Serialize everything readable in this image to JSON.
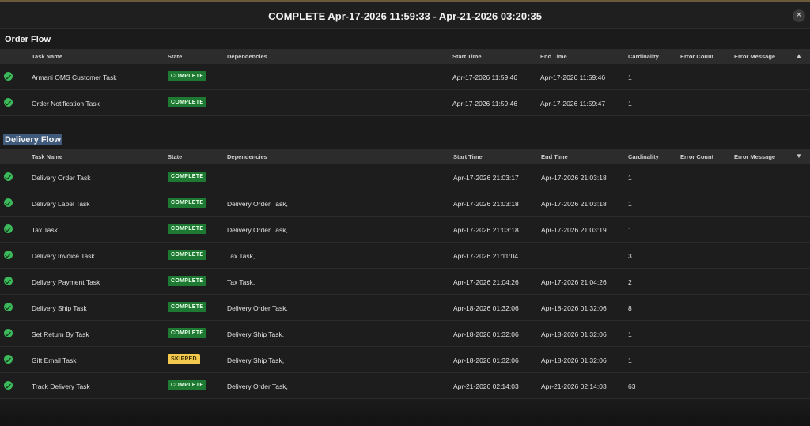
{
  "header": {
    "title": "COMPLETE Apr-17-2026 11:59:33 - Apr-21-2026 03:20:35",
    "close_icon": "close-icon"
  },
  "columns": [
    "Task Name",
    "State",
    "Dependencies",
    "Start Time",
    "End Time",
    "Cardinality",
    "Error Count",
    "Error Message"
  ],
  "order_flow": {
    "title": "Order Flow",
    "collapse_icon": "chevron-up-icon",
    "rows": [
      {
        "name": "Armani OMS Customer Task",
        "state": "COMPLETE",
        "deps": "",
        "start": "Apr-17-2026 11:59:46",
        "end": "Apr-17-2026 11:59:46",
        "card": "1"
      },
      {
        "name": "Order Notification Task",
        "state": "COMPLETE",
        "deps": "",
        "start": "Apr-17-2026 11:59:46",
        "end": "Apr-17-2026 11:59:47",
        "card": "1"
      }
    ]
  },
  "delivery_flow": {
    "title": "Delivery Flow",
    "collapse_icon": "chevron-down-icon",
    "rows": [
      {
        "name": "Delivery Order Task",
        "state": "COMPLETE",
        "deps": "",
        "start": "Apr-17-2026 21:03:17",
        "end": "Apr-17-2026 21:03:18",
        "card": "1"
      },
      {
        "name": "Delivery Label Task",
        "state": "COMPLETE",
        "deps": "Delivery Order Task,",
        "start": "Apr-17-2026 21:03:18",
        "end": "Apr-17-2026 21:03:18",
        "card": "1"
      },
      {
        "name": "Tax Task",
        "state": "COMPLETE",
        "deps": "Delivery Order Task,",
        "start": "Apr-17-2026 21:03:18",
        "end": "Apr-17-2026 21:03:19",
        "card": "1"
      },
      {
        "name": "Delivery Invoice Task",
        "state": "COMPLETE",
        "deps": "Tax Task,",
        "start": "Apr-17-2026 21:11:04",
        "end": "",
        "card": "3"
      },
      {
        "name": "Delivery Payment Task",
        "state": "COMPLETE",
        "deps": "Tax Task,",
        "start": "Apr-17-2026 21:04:26",
        "end": "Apr-17-2026 21:04:26",
        "card": "2"
      },
      {
        "name": "Delivery Ship Task",
        "state": "COMPLETE",
        "deps": "Delivery Order Task,",
        "start": "Apr-18-2026 01:32:06",
        "end": "Apr-18-2026 01:32:06",
        "card": "8"
      },
      {
        "name": "Set Return By Task",
        "state": "COMPLETE",
        "deps": "Delivery Ship Task,",
        "start": "Apr-18-2026 01:32:06",
        "end": "Apr-18-2026 01:32:06",
        "card": "1"
      },
      {
        "name": "Gift Email Task",
        "state": "SKIPPED",
        "deps": "Delivery Ship Task,",
        "start": "Apr-18-2026 01:32:06",
        "end": "Apr-18-2026 01:32:06",
        "card": "1"
      },
      {
        "name": "Track Delivery Task",
        "state": "COMPLETE",
        "deps": "Delivery Order Task,",
        "start": "Apr-21-2026 02:14:03",
        "end": "Apr-21-2026 02:14:03",
        "card": "63"
      }
    ]
  },
  "colors": {
    "complete": "#1e7a33",
    "skipped": "#f2c94c",
    "check": "#3cb95a",
    "highlight": "#3f5a7a"
  }
}
